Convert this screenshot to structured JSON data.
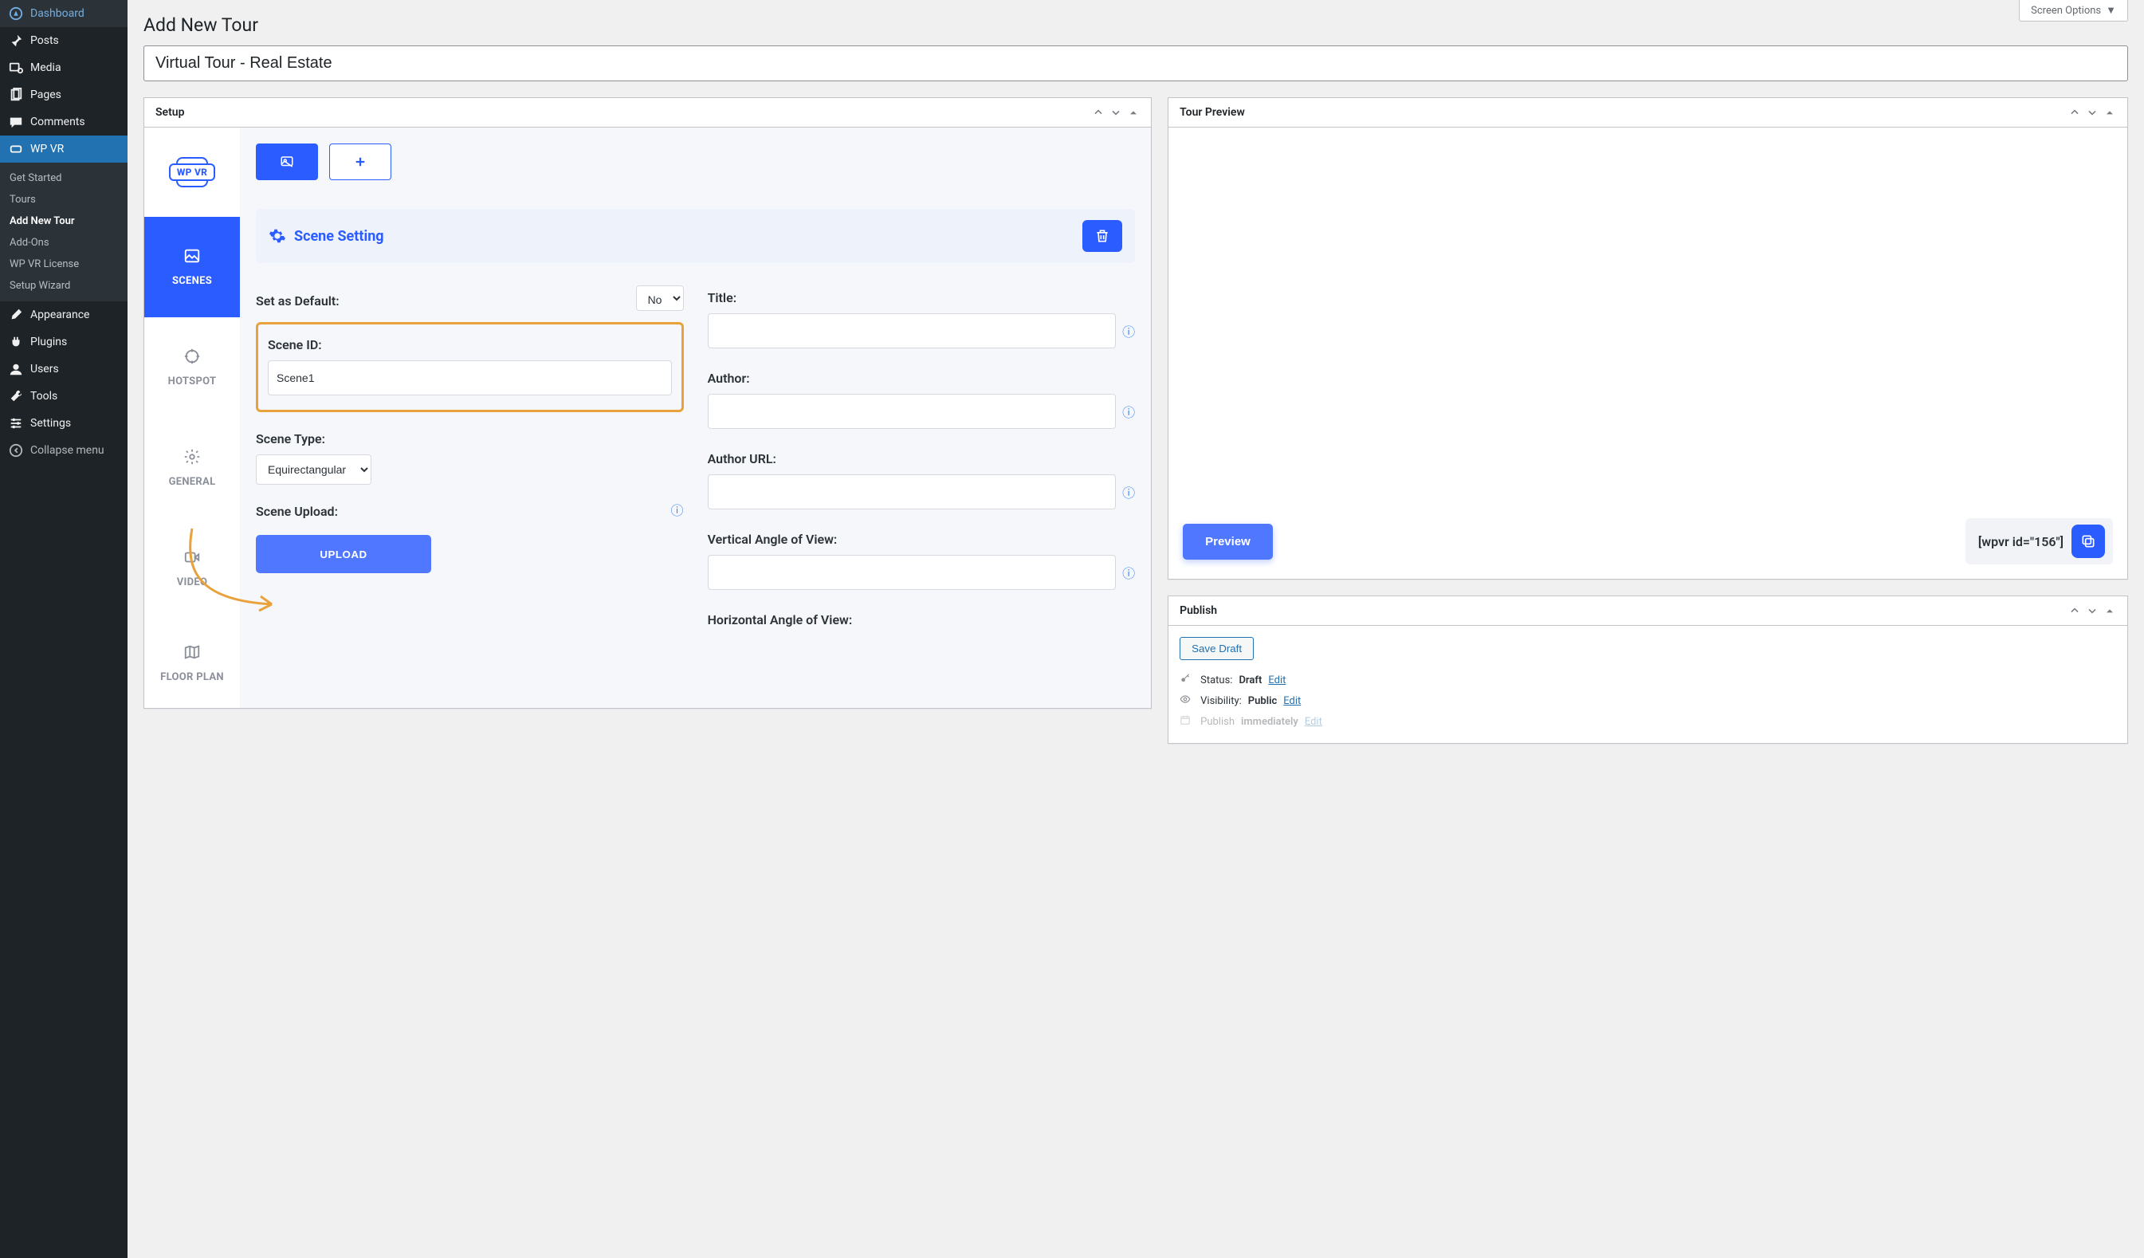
{
  "sidebar": {
    "items": [
      {
        "label": "Dashboard",
        "icon": "◉"
      },
      {
        "label": "Posts",
        "icon": "📌"
      },
      {
        "label": "Media",
        "icon": "🖼"
      },
      {
        "label": "Pages",
        "icon": "📄"
      },
      {
        "label": "Comments",
        "icon": "💬"
      },
      {
        "label": "WP VR",
        "icon": "⬚",
        "active": true
      },
      {
        "label": "Appearance",
        "icon": "🖌"
      },
      {
        "label": "Plugins",
        "icon": "🔌"
      },
      {
        "label": "Users",
        "icon": "👤"
      },
      {
        "label": "Tools",
        "icon": "🔧"
      },
      {
        "label": "Settings",
        "icon": "⚙"
      }
    ],
    "subitems": [
      "Get Started",
      "Tours",
      "Add New Tour",
      "Add-Ons",
      "WP VR License",
      "Setup Wizard"
    ],
    "collapse": "Collapse menu"
  },
  "screen_options": "Screen Options",
  "page_heading": "Add New Tour",
  "title_value": "Virtual Tour - Real Estate",
  "setup": {
    "title": "Setup",
    "tabs": {
      "scenes": "SCENES",
      "hotspot": "HOTSPOT",
      "general": "GENERAL",
      "video": "VIDEO",
      "floorplan": "FLOOR PLAN"
    },
    "scene_setting_label": "Scene Setting",
    "fields": {
      "set_default": {
        "label": "Set as Default:",
        "value": "No"
      },
      "scene_id": {
        "label": "Scene ID:",
        "value": "Scene1"
      },
      "scene_type": {
        "label": "Scene Type:",
        "value": "Equirectangular"
      },
      "scene_upload": {
        "label": "Scene Upload:"
      },
      "upload_btn": "UPLOAD",
      "title": {
        "label": "Title:"
      },
      "author": {
        "label": "Author:"
      },
      "author_url": {
        "label": "Author URL:"
      },
      "v_angle": {
        "label": "Vertical Angle of View:"
      },
      "h_angle": {
        "label": "Horizontal Angle of View:"
      }
    },
    "wpvr_badge": "WP VR"
  },
  "preview": {
    "title": "Tour Preview",
    "button": "Preview",
    "shortcode": "[wpvr id=\"156\"]"
  },
  "publish": {
    "title": "Publish",
    "save_draft": "Save Draft",
    "status_label": "Status:",
    "status_value": "Draft",
    "visibility_label": "Visibility:",
    "visibility_value": "Public",
    "publish_imm_label": "Publish",
    "publish_imm_value": "immediately",
    "edit": "Edit"
  }
}
